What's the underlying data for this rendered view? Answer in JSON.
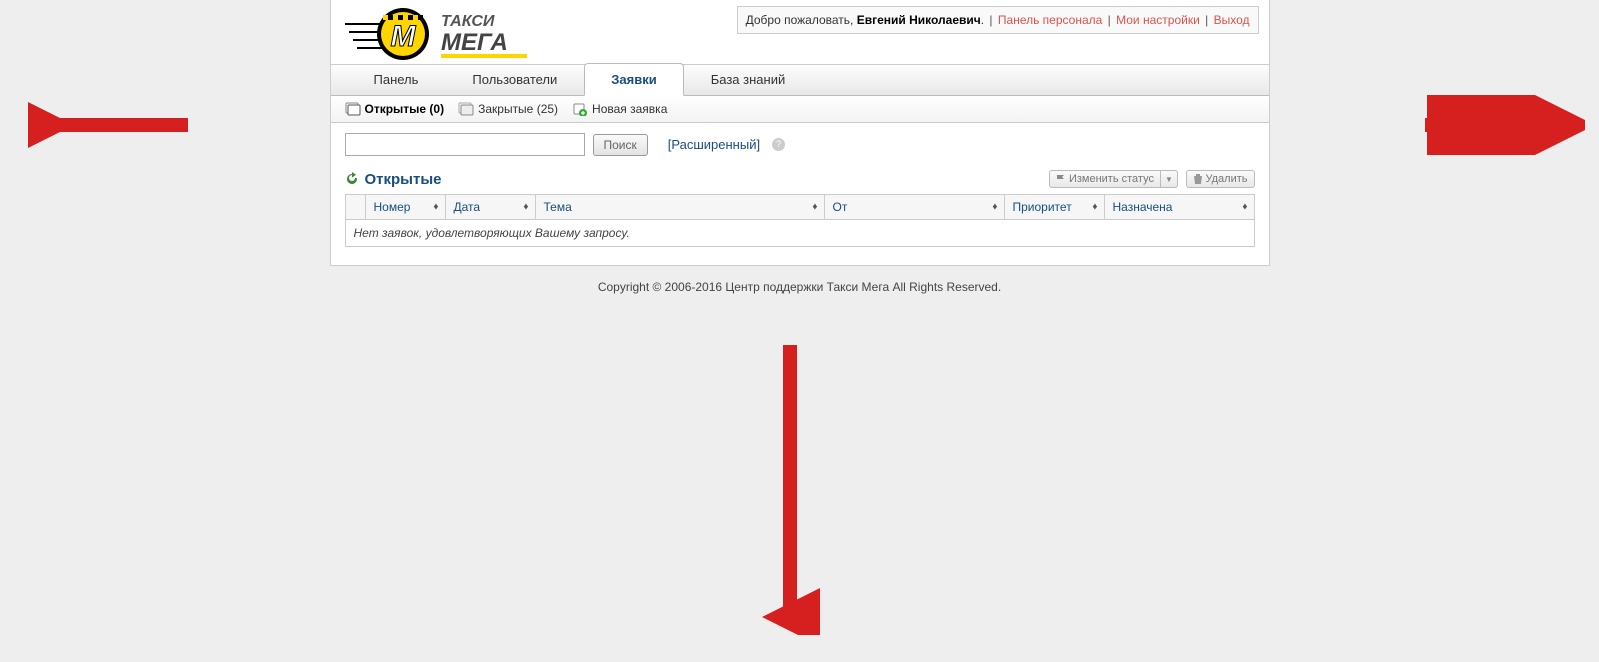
{
  "logo": {
    "line1": "ТАКСИ",
    "line2": "МЕГА"
  },
  "topbar": {
    "welcome": "Добро пожаловать,",
    "user": "Евгений Николаевич",
    "panel": "Панель персонала",
    "settings": "Мои настройки",
    "logout": "Выход"
  },
  "nav": {
    "dashboard": "Панель",
    "users": "Пользователи",
    "tickets": "Заявки",
    "kb": "База знаний"
  },
  "subnav": {
    "open": "Открытые (0)",
    "closed": "Закрытые (25)",
    "new": "Новая заявка"
  },
  "search": {
    "button": "Поиск",
    "advanced": "[Расширенный]"
  },
  "section": {
    "title": "Открытые",
    "change_status": "Изменить статус",
    "delete": "Удалить"
  },
  "table": {
    "col_number": "Номер",
    "col_date": "Дата",
    "col_subject": "Тема",
    "col_from": "От",
    "col_priority": "Приоритет",
    "col_assigned": "Назначена",
    "empty": "Нет заявок, удовлетворяющих Вашему запросу."
  },
  "footer": "Copyright © 2006-2016 Центр поддержки Такси Мега All Rights Reserved."
}
